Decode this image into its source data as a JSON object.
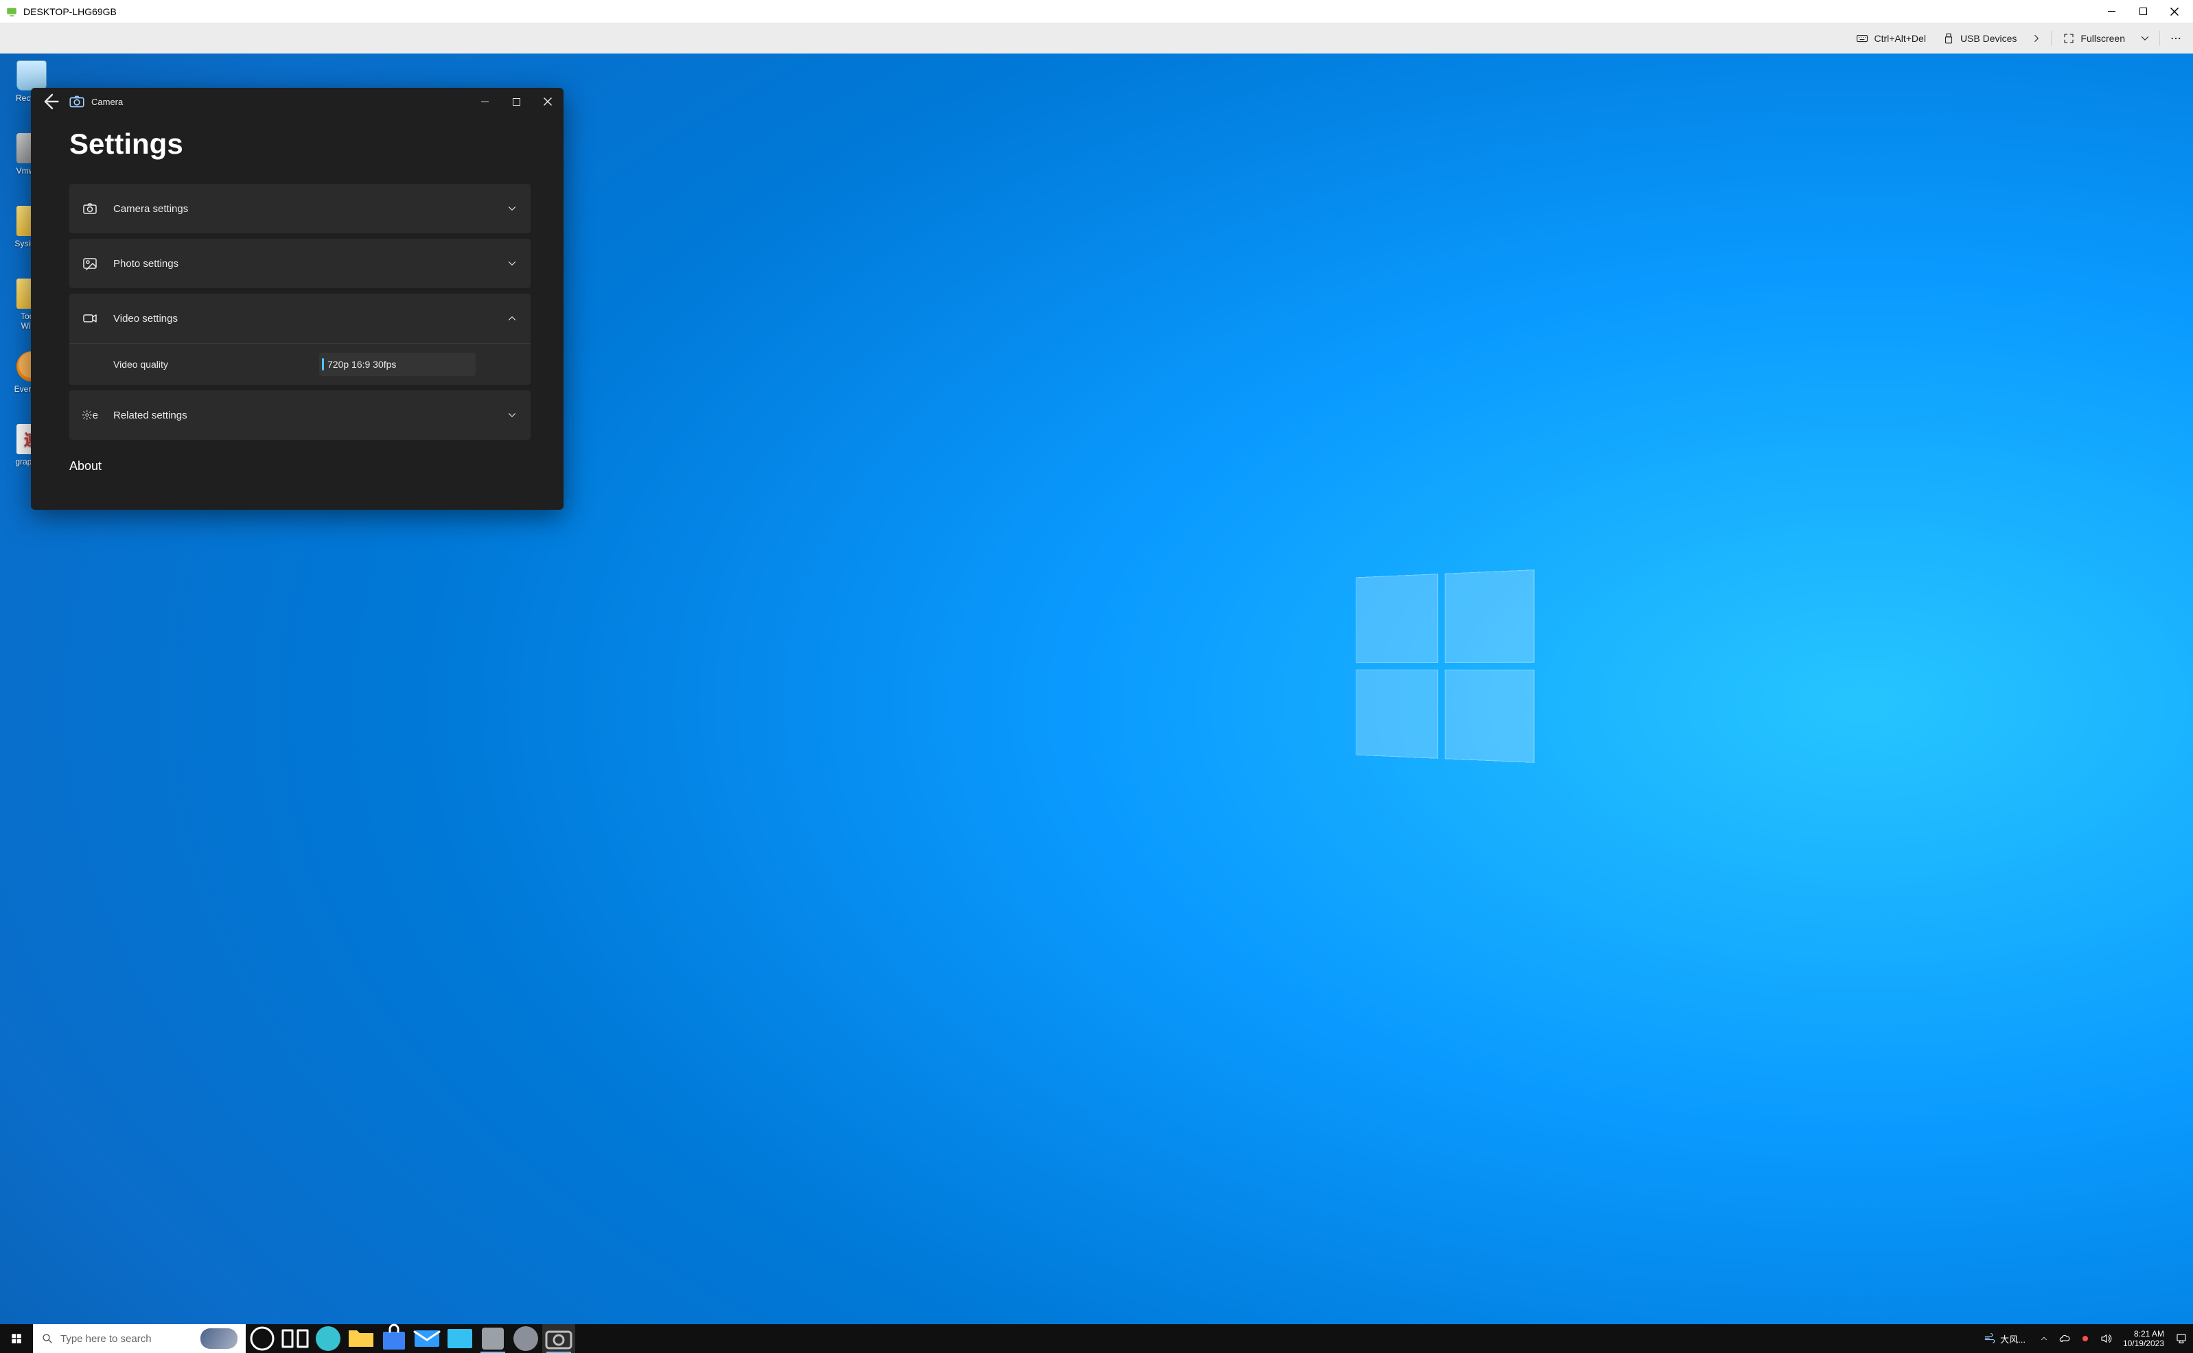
{
  "host": {
    "title": "DESKTOP-LHG69GB"
  },
  "vmToolbar": {
    "ctrlAltDel": "Ctrl+Alt+Del",
    "usbDevices": "USB Devices",
    "fullscreen": "Fullscreen"
  },
  "desktopIcons": [
    {
      "name": "Recycle Bin",
      "label": "Recycl..."
    },
    {
      "name": "VmwAc",
      "label": "VmwA..."
    },
    {
      "name": "Sysinternals",
      "label": "Sysinte..."
    },
    {
      "name": "Tools-Windows",
      "label": "Tools-\nWin..."
    },
    {
      "name": "Everything",
      "label": "Everyth..."
    },
    {
      "name": "graphedit",
      "label": "graphe..."
    }
  ],
  "cameraWindow": {
    "appTitle": "Camera",
    "pageTitle": "Settings",
    "rows": {
      "camera": "Camera settings",
      "photo": "Photo settings",
      "video": "Video settings",
      "videoQualityLabel": "Video quality",
      "videoQualityValue": "720p 16:9 30fps",
      "related": "Related settings",
      "about": "About"
    }
  },
  "taskbar": {
    "searchPlaceholder": "Type here to search",
    "weatherText": "大风...",
    "clockTime": "8:21 AM",
    "clockDate": "10/19/2023"
  }
}
